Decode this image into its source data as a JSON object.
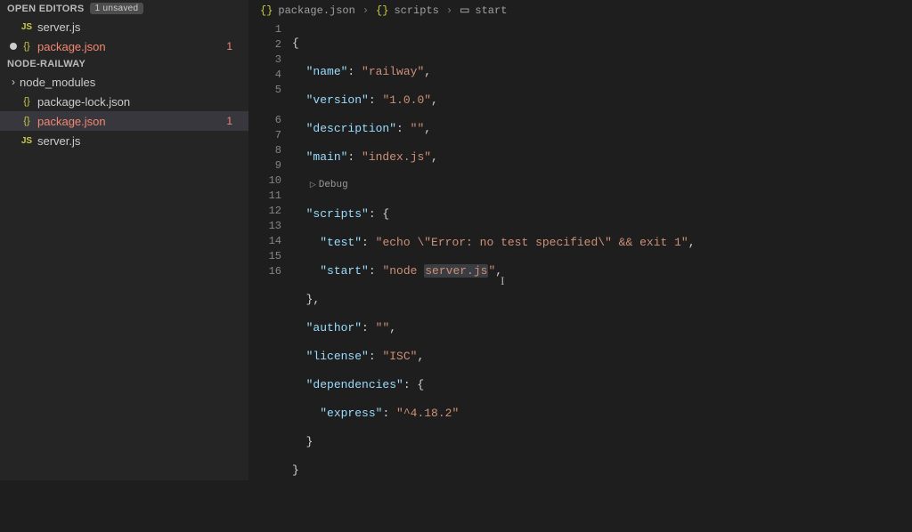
{
  "sidebar": {
    "openEditors": {
      "title": "OPEN EDITORS",
      "badge": "1 unsaved",
      "items": [
        {
          "icon": "js",
          "label": "server.js",
          "error": false,
          "modified": false,
          "count": ""
        },
        {
          "icon": "json",
          "label": "package.json",
          "error": true,
          "modified": true,
          "count": "1"
        }
      ]
    },
    "project": {
      "title": "NODE-RAILWAY",
      "items": [
        {
          "type": "folder",
          "label": "node_modules",
          "error": false,
          "count": ""
        },
        {
          "type": "json",
          "label": "package-lock.json",
          "error": false,
          "count": ""
        },
        {
          "type": "json",
          "label": "package.json",
          "error": true,
          "count": "1",
          "selected": true
        },
        {
          "type": "js",
          "label": "server.js",
          "error": false,
          "count": ""
        }
      ]
    }
  },
  "breadcrumb": {
    "file": "package.json",
    "path1": "scripts",
    "path2": "start"
  },
  "codelens": "Debug",
  "code": {
    "lines": [
      "1",
      "2",
      "3",
      "4",
      "5",
      "6",
      "7",
      "8",
      "9",
      "10",
      "11",
      "12",
      "13",
      "14",
      "15",
      "16"
    ],
    "content": {
      "name_key": "\"name\"",
      "name_val": "\"railway\"",
      "version_key": "\"version\"",
      "version_val": "\"1.0.0\"",
      "description_key": "\"description\"",
      "description_val": "\"\"",
      "main_key": "\"main\"",
      "main_val": "\"index.js\"",
      "scripts_key": "\"scripts\"",
      "test_key": "\"test\"",
      "test_val": "\"echo \\\"Error: no test specified\\\" && exit 1\"",
      "start_key": "\"start\"",
      "start_val_pre": "\"node ",
      "start_val_hl": "server.js",
      "start_val_post": "\"",
      "author_key": "\"author\"",
      "author_val": "\"\"",
      "license_key": "\"license\"",
      "license_val": "\"ISC\"",
      "dependencies_key": "\"dependencies\"",
      "express_key": "\"express\"",
      "express_val": "\"^4.18.2\""
    }
  }
}
